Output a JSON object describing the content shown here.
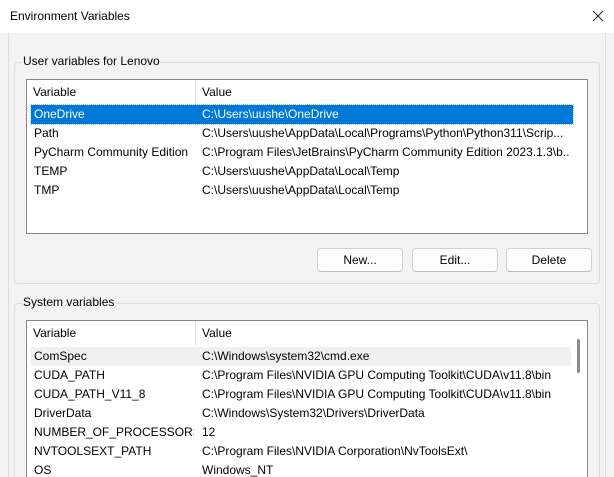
{
  "window": {
    "title": "Environment Variables"
  },
  "user_vars": {
    "group_label": "User variables for Lenovo",
    "columns": [
      "Variable",
      "Value"
    ],
    "rows": [
      {
        "variable": "OneDrive",
        "value": "C:\\Users\\uushe\\OneDrive",
        "selected": true
      },
      {
        "variable": "Path",
        "value": "C:\\Users\\uushe\\AppData\\Local\\Programs\\Python\\Python311\\Scrip...",
        "selected": false
      },
      {
        "variable": "PyCharm Community Edition",
        "value": "C:\\Program Files\\JetBrains\\PyCharm Community Edition 2023.1.3\\b...",
        "selected": false
      },
      {
        "variable": "TEMP",
        "value": "C:\\Users\\uushe\\AppData\\Local\\Temp",
        "selected": false
      },
      {
        "variable": "TMP",
        "value": "C:\\Users\\uushe\\AppData\\Local\\Temp",
        "selected": false
      }
    ],
    "buttons": {
      "new": "New...",
      "edit": "Edit...",
      "delete": "Delete"
    }
  },
  "system_vars": {
    "group_label": "System variables",
    "columns": [
      "Variable",
      "Value"
    ],
    "rows": [
      {
        "variable": "ComSpec",
        "value": "C:\\Windows\\system32\\cmd.exe",
        "hover": true
      },
      {
        "variable": "CUDA_PATH",
        "value": "C:\\Program Files\\NVIDIA GPU Computing Toolkit\\CUDA\\v11.8\\bin",
        "hover": false
      },
      {
        "variable": "CUDA_PATH_V11_8",
        "value": "C:\\Program Files\\NVIDIA GPU Computing Toolkit\\CUDA\\v11.8\\bin",
        "hover": false
      },
      {
        "variable": "DriverData",
        "value": "C:\\Windows\\System32\\Drivers\\DriverData",
        "hover": false
      },
      {
        "variable": "NUMBER_OF_PROCESSORS",
        "value": "12",
        "hover": false
      },
      {
        "variable": "NVTOOLSEXT_PATH",
        "value": "C:\\Program Files\\NVIDIA Corporation\\NvToolsExt\\",
        "hover": false
      },
      {
        "variable": "OS",
        "value": "Windows_NT",
        "hover": false
      }
    ]
  },
  "icons": {
    "close": "close-icon"
  },
  "colors": {
    "selection": "#0078d7",
    "background": "#f3f3f3"
  }
}
